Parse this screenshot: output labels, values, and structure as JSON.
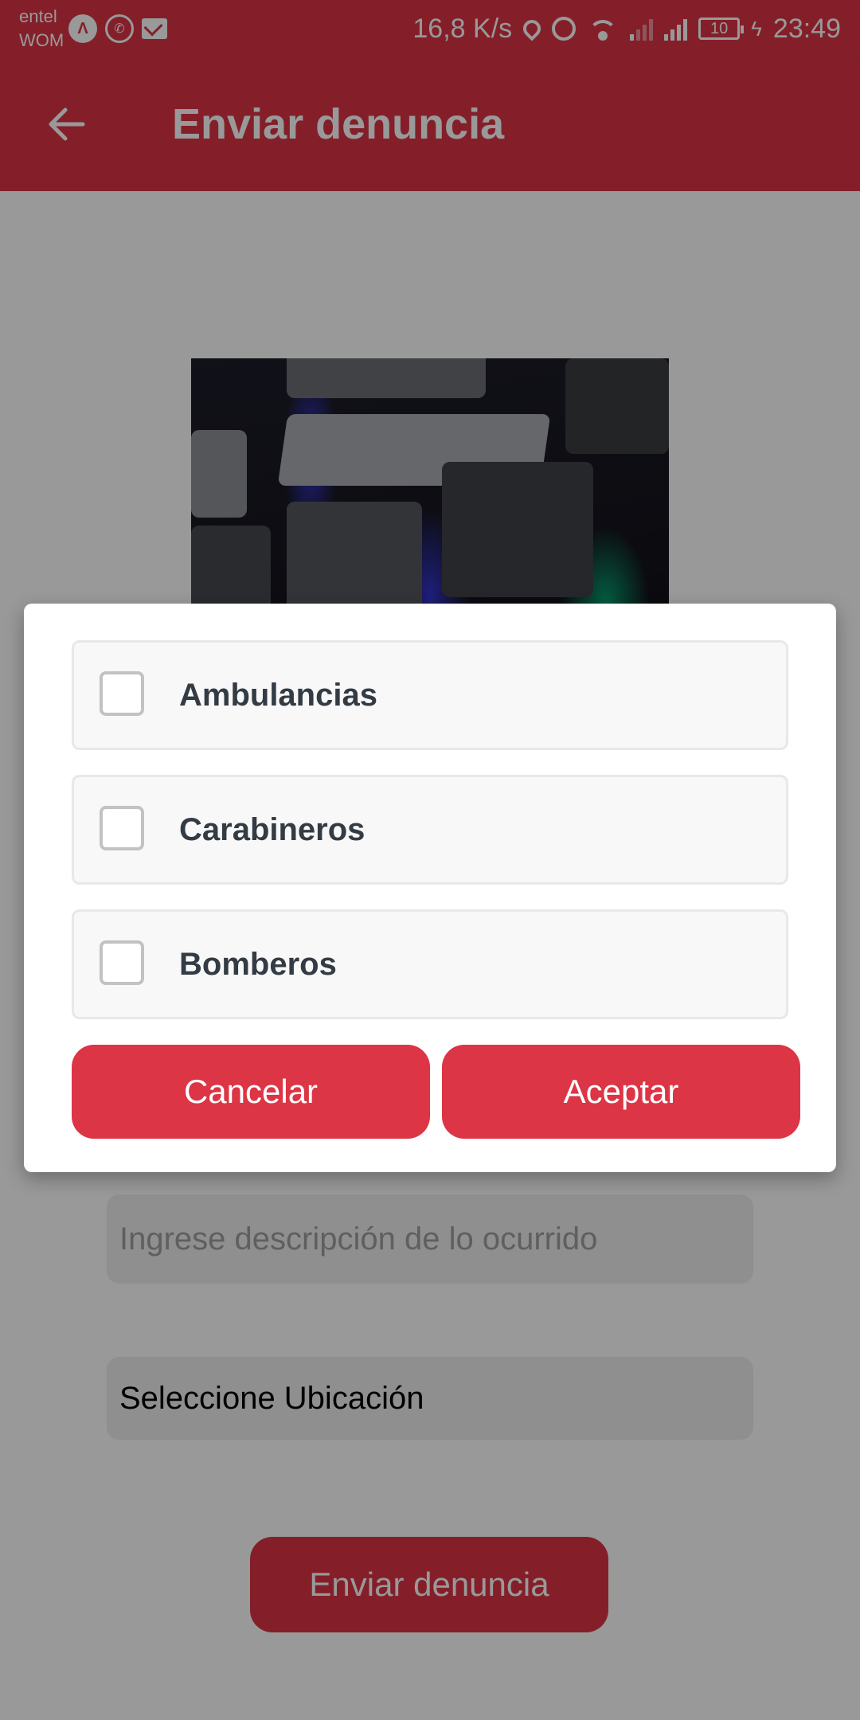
{
  "status_bar": {
    "carrier_1": "entel",
    "carrier_2": "WOM",
    "app_icon_1": "Λ",
    "network_speed": "16,8 K/s",
    "battery": "10",
    "time": "23:49",
    "icons": [
      "assistant-icon",
      "whatsapp-icon",
      "gmail-icon",
      "location-icon",
      "alarm-icon",
      "wifi-icon",
      "signal-icon",
      "battery-icon",
      "charging-icon"
    ]
  },
  "app_bar": {
    "title": "Enviar denuncia",
    "back_icon": "arrow-left-icon"
  },
  "form": {
    "description_placeholder": "Ingrese descripción de lo ocurrido",
    "location_label": "Seleccione Ubicación",
    "submit_label": "Enviar denuncia"
  },
  "dialog": {
    "options": [
      {
        "label": "Ambulancias",
        "checked": false
      },
      {
        "label": "Carabineros",
        "checked": false
      },
      {
        "label": "Bomberos",
        "checked": false
      }
    ],
    "cancel_label": "Cancelar",
    "accept_label": "Aceptar"
  },
  "colors": {
    "primary": "#dc3545",
    "option_text": "#333b44",
    "checkbox_border": "#c2c2c2"
  }
}
